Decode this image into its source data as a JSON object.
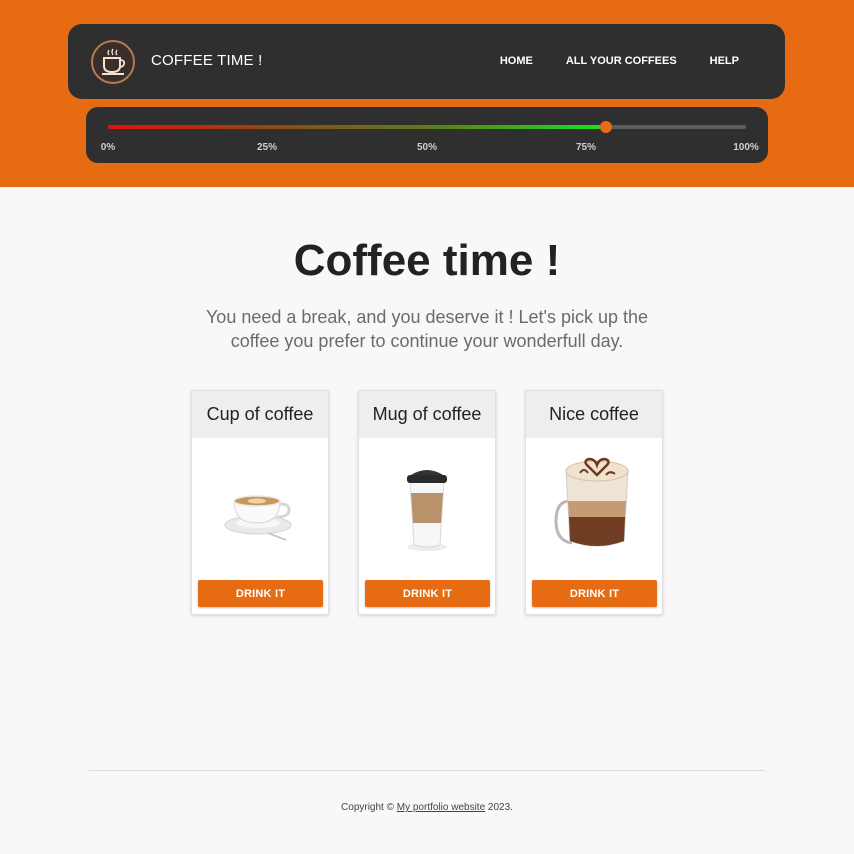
{
  "header": {
    "brand": "COFFEE TIME !",
    "nav": [
      {
        "label": "HOME"
      },
      {
        "label": "ALL YOUR COFFEES"
      },
      {
        "label": "HELP"
      }
    ]
  },
  "progress": {
    "value_percent": 78,
    "ticks": [
      "0%",
      "25%",
      "50%",
      "75%",
      "100%"
    ]
  },
  "main": {
    "title": "Coffee time !",
    "subtitle": "You need a break, and you deserve it ! Let's pick up the coffee you prefer to continue your wonderfull day."
  },
  "cards": [
    {
      "title": "Cup of coffee",
      "button": "DRINK IT",
      "icon": "coffee-cup-icon"
    },
    {
      "title": "Mug of coffee",
      "button": "DRINK IT",
      "icon": "takeaway-cup-icon"
    },
    {
      "title": "Nice coffee",
      "button": "DRINK IT",
      "icon": "latte-glass-icon"
    }
  ],
  "footer": {
    "prefix": "Copyright © ",
    "link": "My portfolio website",
    "suffix": " 2023."
  },
  "colors": {
    "accent": "#e66b12",
    "panel": "#2f2f2f",
    "background": "#f9f7fa"
  }
}
